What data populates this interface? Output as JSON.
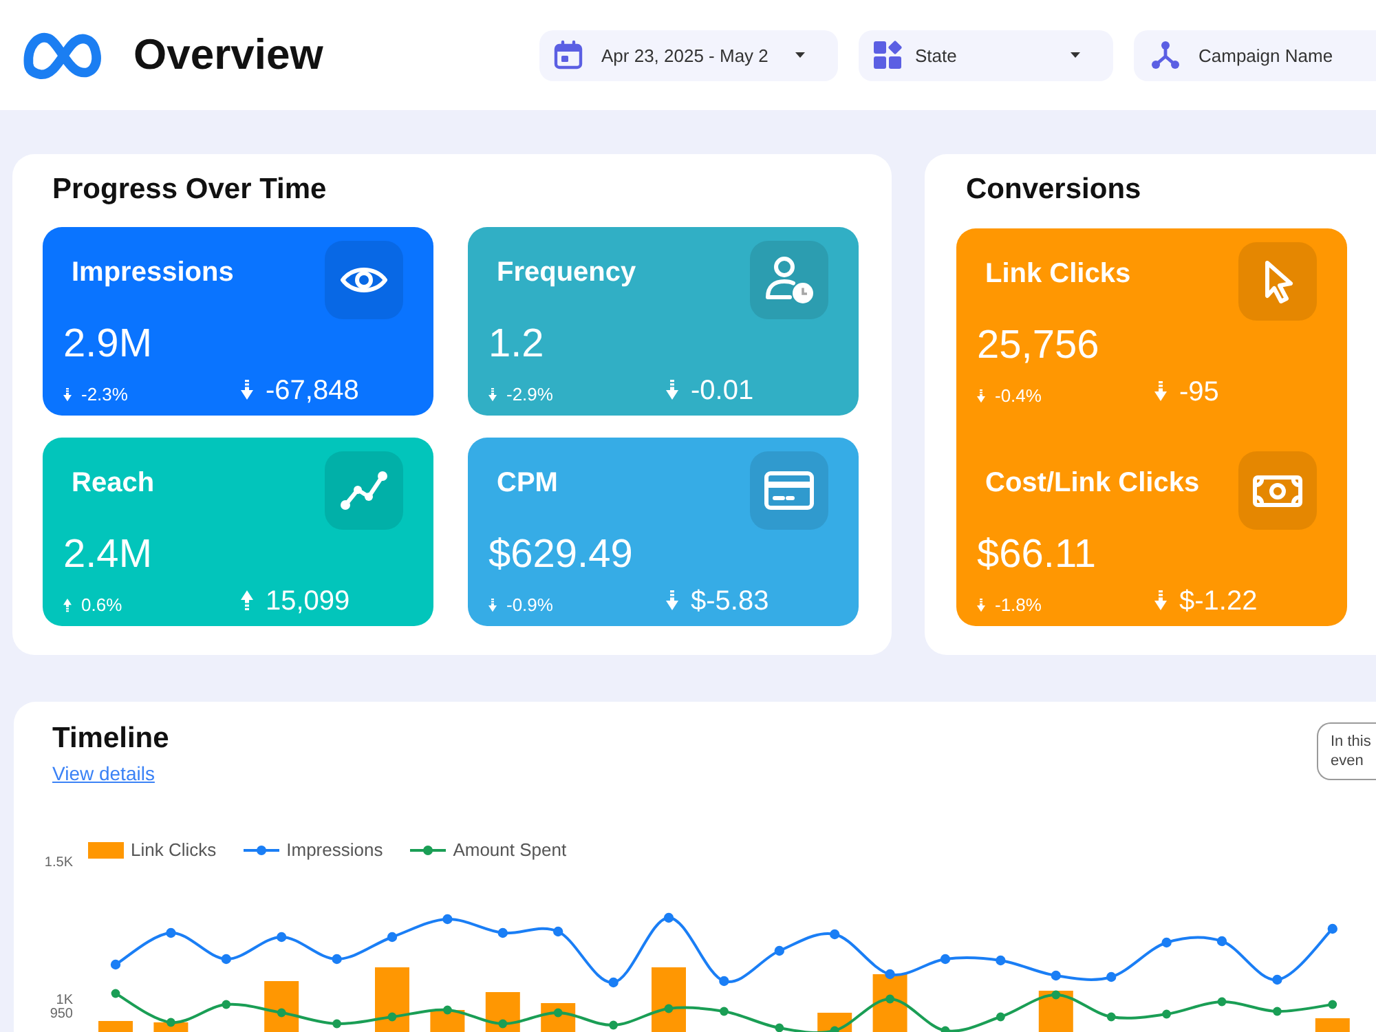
{
  "header": {
    "title": "Overview",
    "filters": [
      {
        "kind": "date",
        "label": "Apr 23, 2025 - May 2",
        "dropdown": true
      },
      {
        "kind": "state",
        "label": "State",
        "dropdown": true
      },
      {
        "kind": "campaign",
        "label": "Campaign Name"
      }
    ]
  },
  "progress": {
    "title": "Progress Over Time",
    "metrics": [
      {
        "kind": "impressions",
        "label": "Impressions",
        "color": "#0a74ff",
        "value": "2.9M",
        "change_pct": {
          "text": "-2.3%",
          "up": false
        },
        "change_abs": {
          "text": "-67,848",
          "up": false
        }
      },
      {
        "kind": "frequency",
        "label": "Frequency",
        "color": "#31afc5",
        "value": "1.2",
        "change_pct": {
          "text": "-2.9%",
          "up": false
        },
        "change_abs": {
          "text": "-0.01",
          "up": false
        }
      },
      {
        "kind": "reach",
        "label": "Reach",
        "color": "#02c5bb",
        "value": "2.4M",
        "change_pct": {
          "text": "0.6%",
          "up": true
        },
        "change_abs": {
          "text": "15,099",
          "up": true
        }
      },
      {
        "kind": "cpm",
        "label": "CPM",
        "color": "#36ace6",
        "value": "$629.49",
        "change_pct": {
          "text": "-0.9%",
          "up": false
        },
        "change_abs": {
          "text": "$-5.83",
          "up": false
        }
      }
    ]
  },
  "conversions": {
    "title": "Conversions",
    "metrics": [
      {
        "kind": "clicks",
        "label": "Link Clicks",
        "value": "25,756",
        "change_pct": {
          "text": "-0.4%",
          "up": false
        },
        "change_abs": {
          "text": "-95",
          "up": false
        }
      },
      {
        "kind": "cost",
        "label": "Cost/Link Clicks",
        "value": "$66.11",
        "change_pct": {
          "text": "-1.8%",
          "up": false
        },
        "change_abs": {
          "text": "$-1.22",
          "up": false
        }
      }
    ]
  },
  "timeline": {
    "title": "Timeline",
    "link": "View details",
    "note_lines": [
      "In this",
      "even"
    ],
    "chart_data": {
      "type": "bar",
      "legend": "top",
      "categories": [
        null,
        null,
        null,
        null,
        null,
        null,
        null,
        null,
        null,
        null,
        null,
        null,
        null,
        null,
        null,
        null,
        null,
        null,
        null,
        null,
        null,
        null,
        null
      ],
      "ylim": [
        885,
        1500
      ],
      "yticks": [
        {
          "value": 1500,
          "label": "1.5K"
        },
        {
          "value": 1000,
          "label": "1K"
        },
        {
          "value": 950,
          "label": "950"
        }
      ],
      "series": [
        {
          "name": "Link Clicks",
          "type": "bar",
          "color": "#ff9702",
          "values": [
            925,
            920,
            null,
            1070,
            null,
            1120,
            965,
            1030,
            990,
            null,
            1120,
            null,
            null,
            955,
            1095,
            null,
            null,
            1035,
            null,
            null,
            null,
            null,
            935
          ]
        },
        {
          "name": "Impressions",
          "type": "line",
          "color": "#1a7ef5",
          "marker": true,
          "values": [
            1130,
            1245,
            1150,
            1230,
            1150,
            1230,
            1295,
            1245,
            1250,
            1065,
            1300,
            1070,
            1180,
            1240,
            1095,
            1150,
            1145,
            1090,
            1085,
            1210,
            1215,
            1075,
            1260
          ]
        },
        {
          "name": "Amount Spent",
          "type": "line",
          "color": "#1a9e55",
          "marker": true,
          "values": [
            1025,
            920,
            985,
            955,
            915,
            940,
            965,
            915,
            955,
            910,
            970,
            960,
            900,
            890,
            1005,
            890,
            940,
            1020,
            940,
            950,
            995,
            960,
            985
          ]
        }
      ]
    }
  }
}
